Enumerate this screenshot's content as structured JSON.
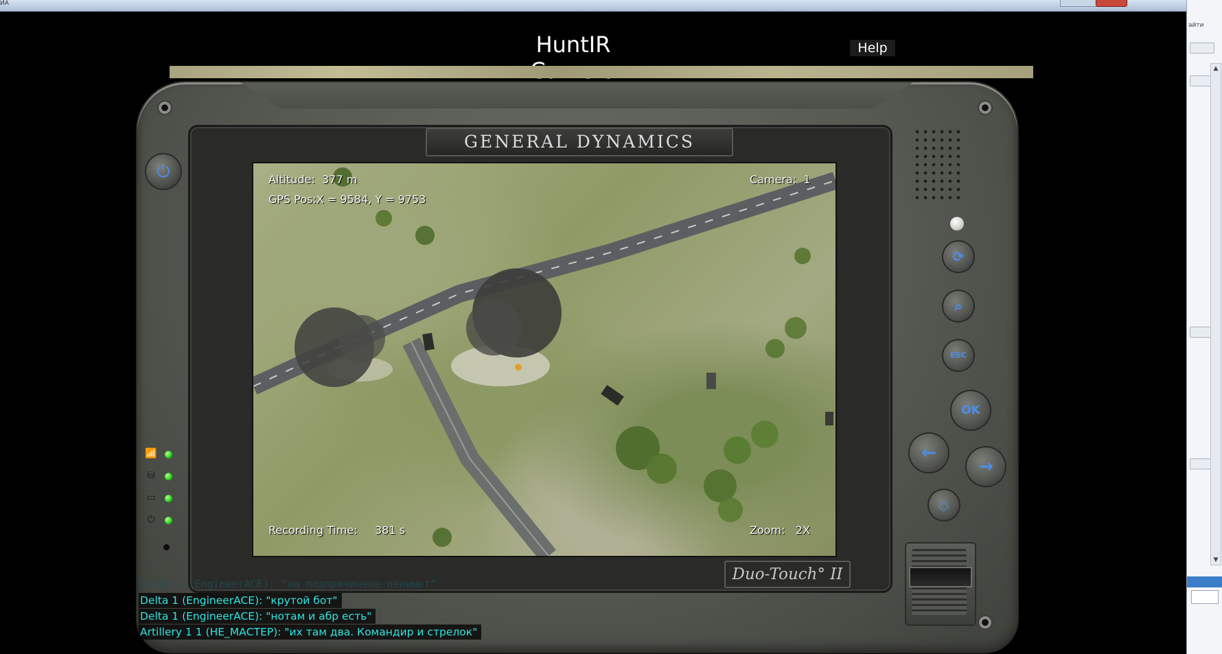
{
  "window": {
    "corner_text": "ИА"
  },
  "header": {
    "title": "HuntIR Camera",
    "help_label": "Help"
  },
  "device": {
    "brand": "GENERAL DYNAMICS",
    "model": "Duo-Touch° II",
    "status_icons": [
      "signal-icon",
      "storage-icon",
      "battery-icon",
      "power-status-icon"
    ],
    "buttons": {
      "power": "power-icon",
      "camera": "camera-switch-icon",
      "zoom": "zoom-icon",
      "esc": "ESC",
      "ok": "OK",
      "left": "←",
      "right": "→",
      "down": "◇"
    },
    "led_color": "#29d51f",
    "button_accent": "#4d8de8"
  },
  "camera": {
    "altitude": "Altitude:  377 m",
    "gps": "GPS Pos:X = 9584, Y = 9753",
    "camera_num": "Camera:  1",
    "recording": "Recording Time:     381 s",
    "zoom": "Zoom:   2X"
  },
  "chat": {
    "faint": "Delta 1 (EngineerACE): \"на подпричинене лёнимет\"",
    "lines": [
      "Delta 1 (EngineerACE): \"крутой бот\"",
      "Delta 1 (EngineerACE): \"нотам и абр есть\"",
      "Artillery 1 1 (НЕ_МАСТЕР): \"их там два. Командир и стрелок\""
    ],
    "color": "#2fe5e2"
  },
  "side_panel": {
    "link": "айти"
  }
}
